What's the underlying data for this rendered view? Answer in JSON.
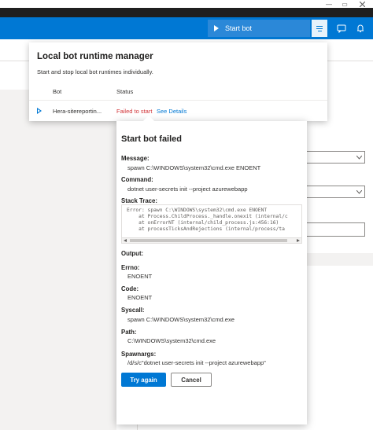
{
  "window": {
    "minimize": "—",
    "restore": "▭"
  },
  "topbar": {
    "start_bot_label": "Start bot"
  },
  "runtime_manager": {
    "title": "Local bot runtime manager",
    "subtitle": "Start and stop local bot runtimes individually.",
    "columns": {
      "bot": "Bot",
      "status": "Status"
    },
    "row": {
      "bot_name": "Hera-sitereportin...",
      "status": "Failed to start",
      "details_link": "See Details"
    }
  },
  "error": {
    "title": "Start bot failed",
    "message_label": "Message:",
    "message": "spawn C:\\WINDOWS\\system32\\cmd.exe ENOENT",
    "command_label": "Command:",
    "command": "dotnet user-secrets init --project azurewebapp",
    "stack_label": "Stack Trace:",
    "stack_trace": "Error: spawn C:\\WINDOWS\\system32\\cmd.exe ENOENT\n    at Process.ChildProcess._handle.onexit (internal/c\n    at onErrorNT (internal/child_process.js:456:16)\n    at processTicksAndRejections (internal/process/ta",
    "output_label": "Output:",
    "errno_label": "Errno:",
    "errno": "ENOENT",
    "code_label": "Code:",
    "code": "ENOENT",
    "syscall_label": "Syscall:",
    "syscall": "spawn C:\\WINDOWS\\system32\\cmd.exe",
    "path_label": "Path:",
    "path": "C:\\WINDOWS\\system32\\cmd.exe",
    "spawnargs_label": "Spawnargs:",
    "spawnargs": "/d/s/c\"dotnet user-secrets init --project azurewebapp\"",
    "try_again": "Try again",
    "cancel": "Cancel"
  },
  "colors": {
    "accent": "#0078d4",
    "error_red": "#d13438"
  }
}
